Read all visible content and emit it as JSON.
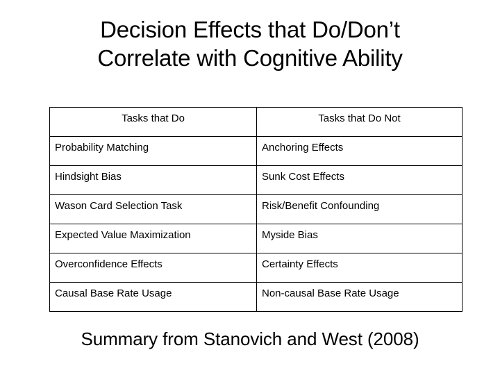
{
  "slide": {
    "title": "Decision Effects that Do/Don’t\nCorrelate with Cognitive Ability",
    "footer": "Summary from Stanovich and West (2008)",
    "background_color": "#ffffff",
    "text_color": "#000000",
    "border_color": "#000000"
  },
  "table": {
    "headers": [
      "Tasks that Do",
      "Tasks that Do Not"
    ],
    "rows": [
      [
        "Probability Matching",
        "Anchoring Effects"
      ],
      [
        "Hindsight Bias",
        "Sunk Cost Effects"
      ],
      [
        "Wason Card Selection Task",
        "Risk/Benefit Confounding"
      ],
      [
        "Expected Value Maximization",
        "Myside Bias"
      ],
      [
        "Overconfidence Effects",
        "Certainty Effects"
      ],
      [
        "Causal Base Rate Usage",
        "Non-causal Base Rate Usage"
      ]
    ]
  }
}
